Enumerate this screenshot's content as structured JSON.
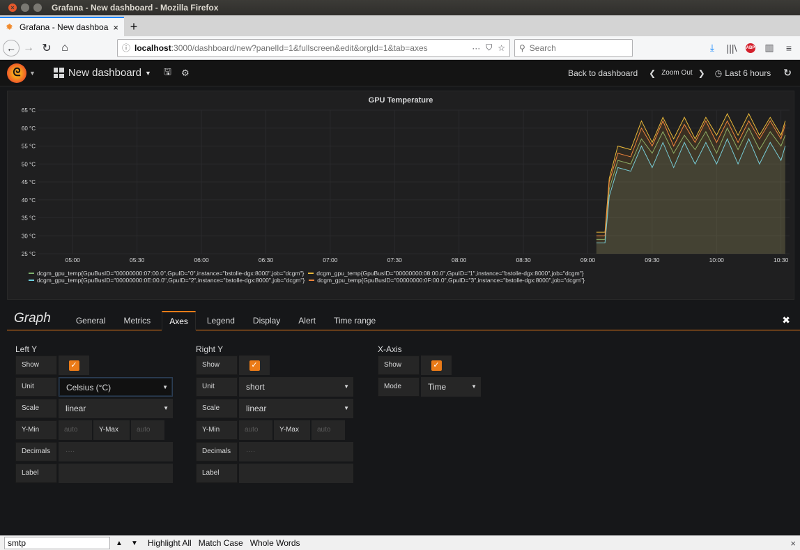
{
  "os": {
    "window_title": "Grafana - New dashboard - Mozilla Firefox"
  },
  "browser": {
    "tab_label": "Grafana - New dashboar",
    "url_host": "localhost",
    "url_path": ":3000/dashboard/new?panelId=1&fullscreen&edit&orgId=1&tab=axes",
    "url_more": "···",
    "search_placeholder": "Search"
  },
  "grafana": {
    "dashboard_name": "New dashboard",
    "back_to_dashboard": "Back to dashboard",
    "zoom_out": "Zoom Out",
    "time_range": "Last 6 hours"
  },
  "graph": {
    "title": "GPU Temperature",
    "y_ticks": [
      "65 °C",
      "60 °C",
      "55 °C",
      "50 °C",
      "45 °C",
      "40 °C",
      "35 °C",
      "30 °C",
      "25 °C"
    ],
    "x_ticks": [
      "05:00",
      "05:30",
      "06:00",
      "06:30",
      "07:00",
      "07:30",
      "08:00",
      "08:30",
      "09:00",
      "09:30",
      "10:00",
      "10:30"
    ],
    "legend": [
      {
        "label": "dcgm_gpu_temp{GpuBusID=\"00000000:07:00.0\",GpuID=\"0\",instance=\"bstolle-dgx:8000\",job=\"dcgm\"}",
        "color": "#7eb26d"
      },
      {
        "label": "dcgm_gpu_temp{GpuBusID=\"00000000:08:00.0\",GpuID=\"1\",instance=\"bstolle-dgx:8000\",job=\"dcgm\"}",
        "color": "#eab839"
      },
      {
        "label": "dcgm_gpu_temp{GpuBusID=\"00000000:0E:00.0\",GpuID=\"2\",instance=\"bstolle-dgx:8000\",job=\"dcgm\"}",
        "color": "#6ed0e0"
      },
      {
        "label": "dcgm_gpu_temp{GpuBusID=\"00000000:0F:00.0\",GpuID=\"3\",instance=\"bstolle-dgx:8000\",job=\"dcgm\"}",
        "color": "#ef843c"
      }
    ]
  },
  "chart_data": {
    "type": "line",
    "title": "GPU Temperature",
    "xlabel": "",
    "ylabel": "",
    "ylim": [
      25,
      65
    ],
    "x_range": [
      "04:44",
      "10:34"
    ],
    "unit": "°C",
    "grid": true,
    "legend_position": "bottom",
    "x": [
      "09:04",
      "09:08",
      "09:10",
      "09:14",
      "09:20",
      "09:25",
      "09:30",
      "09:35",
      "09:40",
      "09:45",
      "09:50",
      "09:55",
      "10:00",
      "10:05",
      "10:10",
      "10:15",
      "10:20",
      "10:25",
      "10:30",
      "10:32"
    ],
    "series": [
      {
        "name": "dcgm_gpu_temp{GpuBusID=\"00000000:07:00.0\",GpuID=\"0\",instance=\"bstolle-dgx:8000\",job=\"dcgm\"}",
        "values": [
          29,
          29,
          43,
          51,
          50,
          57,
          53,
          59,
          53,
          58,
          54,
          59,
          53,
          60,
          54,
          60,
          54,
          59,
          55,
          58
        ]
      },
      {
        "name": "dcgm_gpu_temp{GpuBusID=\"00000000:08:00.0\",GpuID=\"1\",instance=\"bstolle-dgx:8000\",job=\"dcgm\"}",
        "values": [
          31,
          31,
          46,
          55,
          54,
          62,
          56,
          63,
          57,
          63,
          57,
          63,
          58,
          64,
          58,
          64,
          58,
          63,
          58,
          62
        ]
      },
      {
        "name": "dcgm_gpu_temp{GpuBusID=\"00000000:0E:00.0\",GpuID=\"2\",instance=\"bstolle-dgx:8000\",job=\"dcgm\"}",
        "values": [
          28,
          28,
          41,
          49,
          48,
          55,
          49,
          56,
          49,
          56,
          50,
          56,
          50,
          57,
          50,
          57,
          50,
          56,
          51,
          55
        ]
      },
      {
        "name": "dcgm_gpu_temp{GpuBusID=\"00000000:0F:00.0\",GpuID=\"3\",instance=\"bstolle-dgx:8000\",job=\"dcgm\"}",
        "values": [
          30,
          30,
          45,
          53,
          52,
          60,
          55,
          62,
          55,
          61,
          56,
          62,
          56,
          62,
          56,
          62,
          57,
          62,
          57,
          61
        ]
      }
    ]
  },
  "edit": {
    "title": "Graph",
    "tabs": [
      "General",
      "Metrics",
      "Axes",
      "Legend",
      "Display",
      "Alert",
      "Time range"
    ],
    "left_y": {
      "title": "Left Y",
      "show_label": "Show",
      "unit_label": "Unit",
      "unit_value": "Celsius (°C)",
      "scale_label": "Scale",
      "scale_value": "linear",
      "ymin_label": "Y-Min",
      "ymin_placeholder": "auto",
      "ymax_label": "Y-Max",
      "ymax_placeholder": "auto",
      "decimals_label": "Decimals",
      "decimals_placeholder": "····",
      "label_label": "Label"
    },
    "right_y": {
      "title": "Right Y",
      "show_label": "Show",
      "unit_label": "Unit",
      "unit_value": "short",
      "scale_label": "Scale",
      "scale_value": "linear",
      "ymin_label": "Y-Min",
      "ymin_placeholder": "auto",
      "ymax_label": "Y-Max",
      "ymax_placeholder": "auto",
      "decimals_label": "Decimals",
      "decimals_placeholder": "····",
      "label_label": "Label"
    },
    "x_axis": {
      "title": "X-Axis",
      "show_label": "Show",
      "mode_label": "Mode",
      "mode_value": "Time"
    }
  },
  "findbar": {
    "query": "smtp",
    "highlight_all": "Highlight All",
    "match_case": "Match Case",
    "whole_words": "Whole Words"
  },
  "colors": {
    "accent": "#eb7b18",
    "panel_bg": "#1f1f20",
    "page_bg": "#161719"
  }
}
